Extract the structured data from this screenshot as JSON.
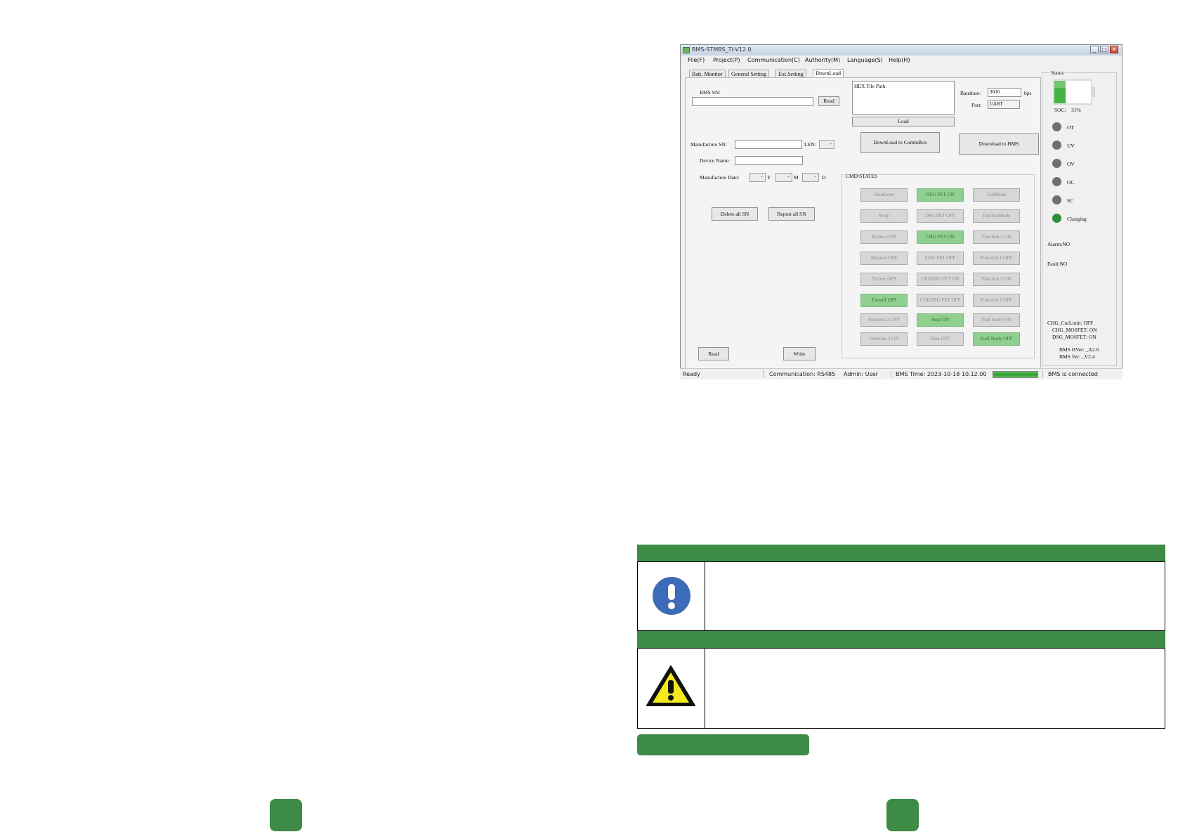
{
  "window": {
    "title": "BMS-STMBS_TI-V12.0",
    "controls": [
      "_",
      "□",
      "✕"
    ]
  },
  "menu": [
    "File(F)",
    "Project(P)",
    "Communication(C)",
    "Authority(M)",
    "Language(S)",
    "Help(H)"
  ],
  "tabs": [
    "Batt. Monitor",
    "General Setting",
    "Ext.Setting",
    "DownLoad"
  ],
  "form": {
    "bms_sn_label": "BMS SN:",
    "bms_sn_value": "",
    "read_top": "Read",
    "manufacture_sn_label": "Manufacture SN:",
    "len_label": "LEN:",
    "device_name_label": "Device Name:",
    "manufacture_date_label": "Manufacture Date:",
    "y": "Y",
    "m": "M",
    "d": "D",
    "delete_all_sn": "Delete all SN",
    "report_all_sn": "Report all SN",
    "read_bottom": "Read",
    "write": "Write"
  },
  "download": {
    "hex_label": "HEX File Path:",
    "load": "Load",
    "baudrate_label": "Baudrate:",
    "baudrate_value": "9600",
    "bps": "bps",
    "port_label": "Port:",
    "port_value": "UART",
    "download_to_commbox": "DownLoad to CommBox",
    "download_to_bms": "Download to BMS"
  },
  "cmd": {
    "title": "CMD/STATES",
    "buttons": [
      {
        "label": "Shutdown",
        "on": false
      },
      {
        "label": "DSG FET ON",
        "on": true
      },
      {
        "label": "TestMode",
        "on": false
      },
      {
        "label": "Sleep",
        "on": false
      },
      {
        "label": "DSG FET OFF",
        "on": false
      },
      {
        "label": "ExitTestMode",
        "on": false
      },
      {
        "label": "Balance ON",
        "on": false
      },
      {
        "label": "CHG FET ON",
        "on": true
      },
      {
        "label": "Function 1  ON",
        "on": false
      },
      {
        "label": "Balance OFF",
        "on": false
      },
      {
        "label": "CHG FET OFF",
        "on": false
      },
      {
        "label": "Function 1  OFF",
        "on": false
      },
      {
        "label": "Turnon GPS",
        "on": false
      },
      {
        "label": "CHGDSG FET ON",
        "on": false
      },
      {
        "label": "Function 2  ON",
        "on": false
      },
      {
        "label": "Turnoff GPS",
        "on": true
      },
      {
        "label": "CHGDSG FET OFF",
        "on": false
      },
      {
        "label": "Function 2  OFF",
        "on": false
      },
      {
        "label": "Function 3  OFF",
        "on": false
      },
      {
        "label": "Heat ON",
        "on": true
      },
      {
        "label": "Fuel Study ON",
        "on": false
      },
      {
        "label": "Function 3  ON",
        "on": false
      },
      {
        "label": "Heat OFF",
        "on": false
      },
      {
        "label": "Fuel Study OFF",
        "on": true
      }
    ]
  },
  "status": {
    "title": "Status",
    "soc_label": "SOC:",
    "soc_value": "31%",
    "soc_fraction": 0.31,
    "indicators": [
      {
        "label": "OT",
        "on": false
      },
      {
        "label": "UV",
        "on": false
      },
      {
        "label": "OV",
        "on": false
      },
      {
        "label": "OC",
        "on": false
      },
      {
        "label": "SC",
        "on": false
      },
      {
        "label": "Charging",
        "on": true
      }
    ],
    "alarm": "Alarm:NO",
    "fault": "Fault:NO",
    "chg_curlimit": "CHG_CurLimit: OFF",
    "chg_mosfet": "CHG_MOSFET: ON",
    "dsg_mosfet": "DSG_MOSFET: ON",
    "hver": "BMS HVer: _A2.0",
    "sver": "BMS Ver: _V2.4"
  },
  "statusbar": {
    "ready": "Ready",
    "communication": "Communication:  RS485",
    "admin": "Admin:  User",
    "bms_time": "BMS Time:  2023-10-18 10.12.00",
    "connected": "BMS is connected"
  },
  "colors": {
    "brand_green": "#3e8b45",
    "on_button": "#8fd08f",
    "info_blue": "#3d6bb8",
    "warn_yellow": "#f2ea1d"
  },
  "icons": [
    "info-exclamation-icon",
    "warning-triangle-icon"
  ]
}
